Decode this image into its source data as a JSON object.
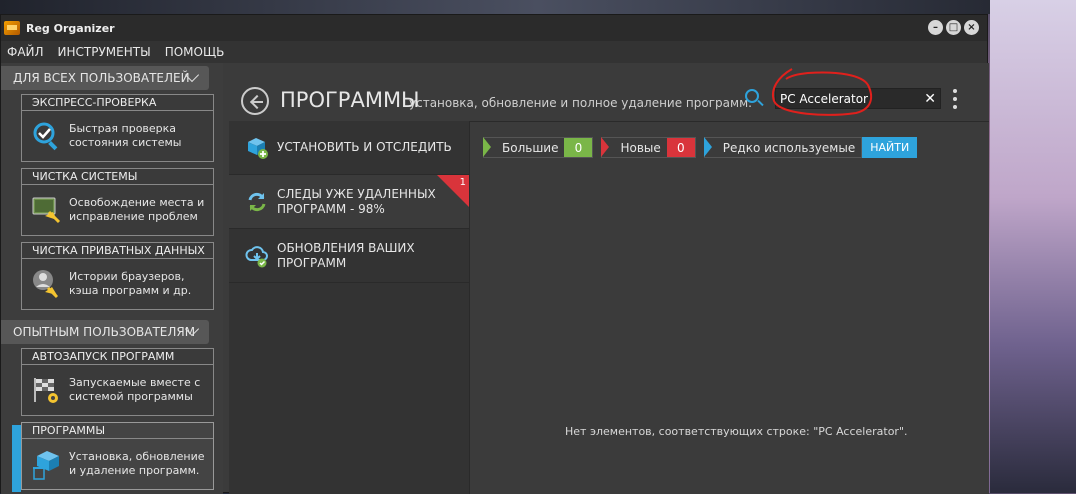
{
  "window": {
    "title": "Reg Organizer"
  },
  "menu": {
    "items": [
      "ФАЙЛ",
      "ИНСТРУМЕНТЫ",
      "ПОМОЩЬ"
    ]
  },
  "sidebar": {
    "groups": [
      {
        "title": "ДЛЯ ВСЕХ ПОЛЬЗОВАТЕЛЕЙ",
        "cards": [
          {
            "title": "ЭКСПРЕСС-ПРОВЕРКА",
            "text": [
              "Быстрая проверка",
              "состояния системы"
            ],
            "icon": "checkmark-magnifier-icon"
          },
          {
            "title": "ЧИСТКА СИСТЕМЫ",
            "text": [
              "Освобождение места и",
              "исправление проблем"
            ],
            "icon": "broom-screen-icon"
          },
          {
            "title": "ЧИСТКА ПРИВАТНЫХ ДАННЫХ",
            "text": [
              "Истории браузеров,",
              "кэша программ и др."
            ],
            "icon": "privacy-broom-icon"
          }
        ]
      },
      {
        "title": "ОПЫТНЫМ ПОЛЬЗОВАТЕЛЯМ",
        "cards": [
          {
            "title": "АВТОЗАПУСК ПРОГРАММ",
            "text": [
              "Запускаемые вместе с",
              "системой программы"
            ],
            "icon": "startup-flag-icon"
          },
          {
            "title": "ПРОГРАММЫ",
            "text": [
              "Установка, обновление",
              "и удаление программ."
            ],
            "icon": "box-trash-icon",
            "active": true
          }
        ]
      }
    ]
  },
  "main": {
    "title": "ПРОГРАММЫ",
    "subtitle": "установка, обновление и полное удаление программ.",
    "search": {
      "value": "PC Accelerator",
      "placeholder": ""
    },
    "left_list": [
      {
        "label": [
          "УСТАНОВИТЬ И ОТСЛЕДИТЬ"
        ],
        "icon": "install-box-icon"
      },
      {
        "label": [
          "СЛЕДЫ УЖЕ УДАЛЕННЫХ",
          "ПРОГРАММ - 98%"
        ],
        "icon": "refresh-icon",
        "badge": "1"
      },
      {
        "label": [
          "ОБНОВЛЕНИЯ ВАШИХ",
          "ПРОГРАММ"
        ],
        "icon": "cloud-update-icon"
      }
    ],
    "filters": [
      {
        "label": "Большие",
        "count": "0",
        "color": "#7ab648"
      },
      {
        "label": "Новые",
        "count": "0",
        "color": "#d9343b"
      },
      {
        "label": "Редко используемые",
        "count": "",
        "color": "#2ea3dc"
      }
    ],
    "find_button": "НАЙТИ",
    "empty_message": "Нет элементов, соответствующих строке: \"PC Accelerator\"."
  },
  "colors": {
    "accent": "#2ea3dc",
    "green": "#7ab648",
    "red": "#d9343b",
    "annotation": "#e0201c"
  }
}
